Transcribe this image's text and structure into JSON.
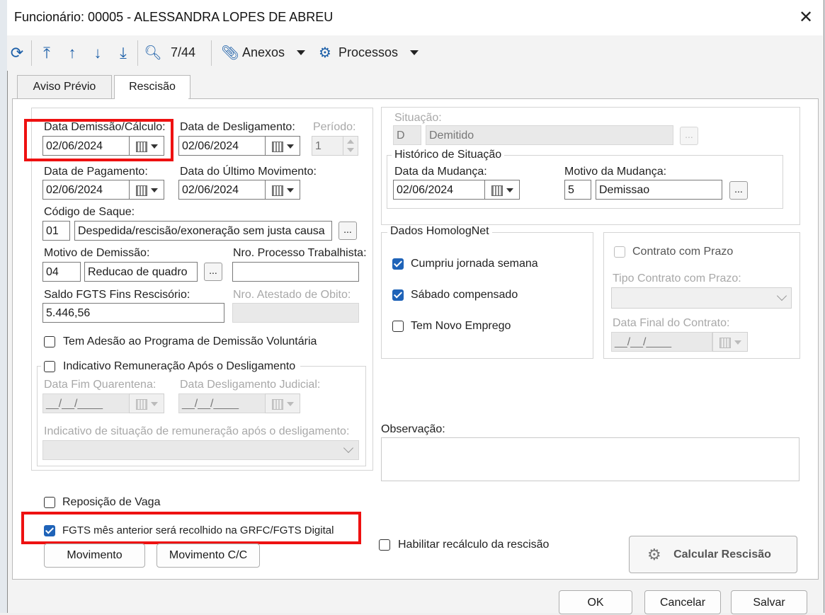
{
  "window": {
    "title": "Funcionário: 00005 - ALESSANDRA LOPES DE ABREU"
  },
  "toolbar": {
    "record_position": "7/44",
    "anexos_label": "Anexos",
    "processos_label": "Processos"
  },
  "tabs": [
    {
      "label": "Aviso Prévio"
    },
    {
      "label": "Rescisão"
    }
  ],
  "left": {
    "data_demissao": {
      "label": "Data Demissão/Cálculo:",
      "value": "02/06/2024"
    },
    "data_desligamento": {
      "label": "Data de Desligamento:",
      "value": "02/06/2024"
    },
    "periodo": {
      "label": "Período:",
      "value": "1"
    },
    "data_pagamento": {
      "label": "Data de Pagamento:",
      "value": "02/06/2024"
    },
    "data_ultimo_mov": {
      "label": "Data do Último Movimento:",
      "value": "02/06/2024"
    },
    "codigo_saque": {
      "label": "Código de Saque:",
      "code": "01",
      "desc": "Despedida/rescisão/exoneração sem justa causa"
    },
    "motivo_demissao": {
      "label": "Motivo de Demissão:",
      "code": "04",
      "desc": "Reducao de quadro"
    },
    "nro_processo": {
      "label": "Nro. Processo Trabalhista:",
      "value": ""
    },
    "saldo_fgts": {
      "label": "Saldo FGTS Fins Rescisório:",
      "value": "5.446,56"
    },
    "nro_atestado": {
      "label": "Nro. Atestado de Obito:",
      "value": ""
    },
    "adesao_pdv": {
      "label": "Tem Adesão ao Programa de Demissão Voluntária",
      "checked": false
    },
    "indicativo_remun": {
      "label": "Indicativo Remuneração Após o Desligamento",
      "checked": false
    },
    "data_fim_quarentena": {
      "label": "Data Fim Quarentena:",
      "value": "__/__/____"
    },
    "data_deslig_judicial": {
      "label": "Data Desligamento Judicial:",
      "value": "__/__/____"
    },
    "indicativo_situacao": {
      "label": "Indicativo de situação de remuneração após o desligamento:",
      "value": ""
    }
  },
  "situacao": {
    "label": "Situação:",
    "code": "D",
    "desc": "Demitido",
    "historico_title": "Histórico de Situação",
    "data_mudanca": {
      "label": "Data da Mudança:",
      "value": "02/06/2024"
    },
    "motivo_mudanca": {
      "label": "Motivo da Mudança:",
      "code": "5",
      "desc": "Demissao"
    }
  },
  "homolognet": {
    "title": "Dados HomologNet",
    "items": [
      {
        "label": "Cumpriu jornada semana",
        "checked": true
      },
      {
        "label": "Sábado compensado",
        "checked": true
      },
      {
        "label": "Tem Novo Emprego",
        "checked": false
      }
    ]
  },
  "contrato": {
    "contrato_prazo_label": "Contrato com Prazo",
    "tipo_label": "Tipo Contrato com Prazo:",
    "data_final_label": "Data Final do Contrato:",
    "data_final_value": "__/__/____"
  },
  "observacao": {
    "label": "Observação:",
    "value": ""
  },
  "bottom": {
    "reposicao_vaga": {
      "label": "Reposição de Vaga",
      "checked": false
    },
    "fgts_mes_anterior": {
      "label": "FGTS mês anterior será recolhido na GRFC/FGTS Digital",
      "checked": true
    },
    "habilitar_recalculo": {
      "label": "Habilitar recálculo da rescisão",
      "checked": false
    },
    "movimento_label": "Movimento",
    "movimento_cc_label": "Movimento C/C",
    "calcular_label": "Calcular Rescisão"
  },
  "footer": {
    "ok": "OK",
    "cancel": "Cancelar",
    "save": "Salvar"
  },
  "colors": {
    "accent": "#1f63b8",
    "highlight_box": "#ee1111",
    "icon_blue": "#1c5fa8"
  }
}
